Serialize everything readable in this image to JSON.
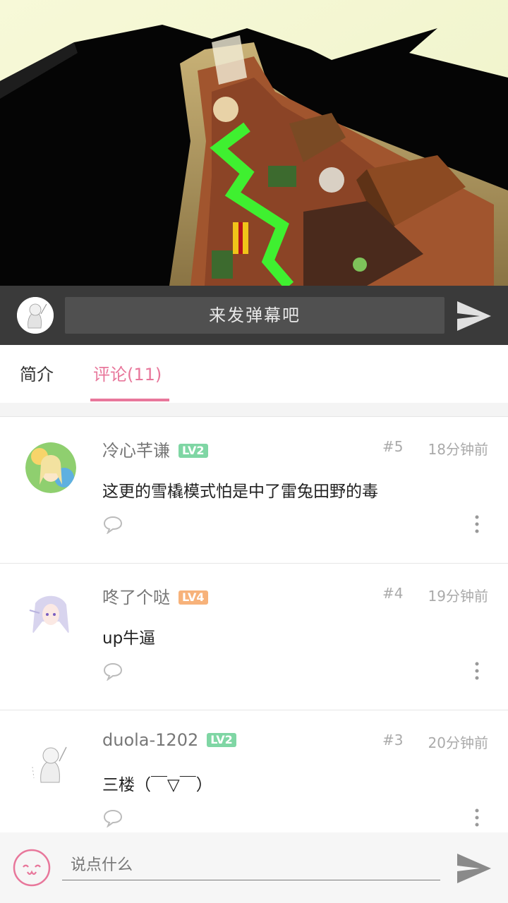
{
  "video": {
    "description_icon": "video-frame"
  },
  "danmaku": {
    "placeholder": "来发弹幕吧",
    "send_icon": "send-icon"
  },
  "tabs": [
    {
      "label": "简介"
    },
    {
      "label": "评论(11)"
    }
  ],
  "comments": [
    {
      "username": "冷心芊谦",
      "level": "LV2",
      "level_color": "#7fd6a4",
      "floor": "#5",
      "time": "18分钟前",
      "content": "这更的雪橇模式怕是中了雷兔田野的毒"
    },
    {
      "username": "咚了个哒",
      "level": "LV4",
      "level_color": "#f7b27a",
      "floor": "#4",
      "time": "19分钟前",
      "content": "up牛逼"
    },
    {
      "username": "duola-1202",
      "level": "LV2",
      "level_color": "#7fd6a4",
      "floor": "#3",
      "time": "20分钟前",
      "content": "三楼（￣▽￣）"
    }
  ],
  "bottom": {
    "placeholder": "说点什么"
  },
  "colors": {
    "accent": "#e8779b",
    "bar": "#3a3a3a"
  }
}
